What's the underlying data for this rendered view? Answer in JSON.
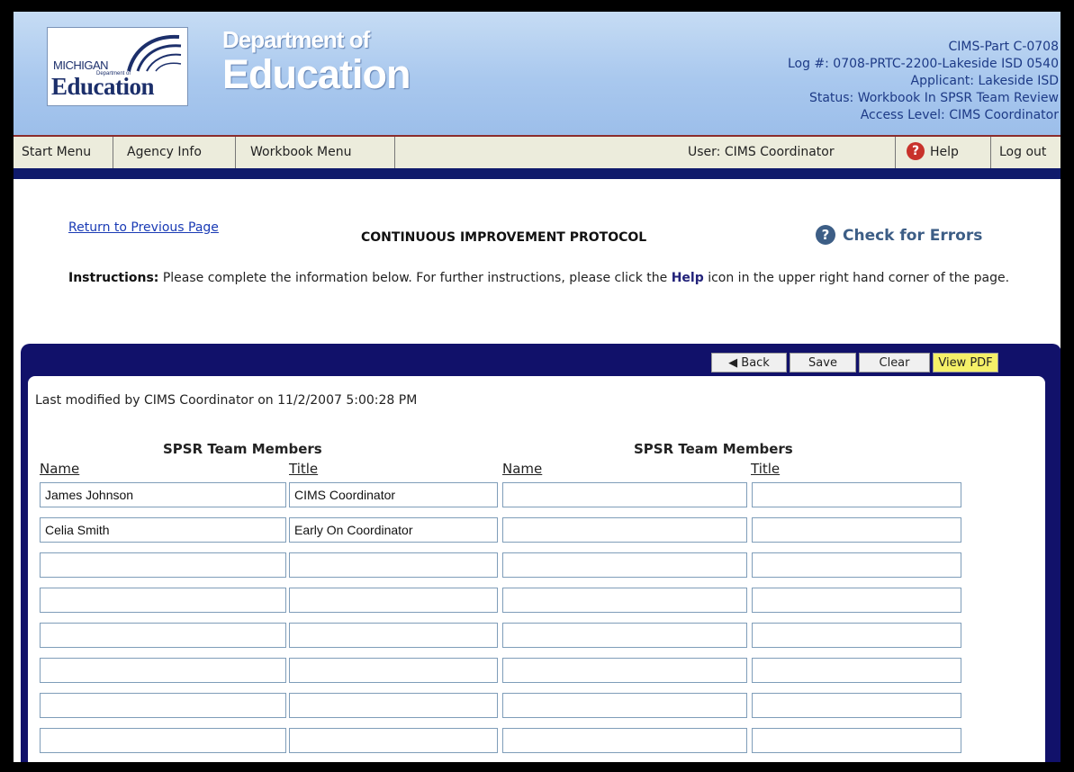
{
  "header": {
    "logo": {
      "michigan": "MICHIGAN",
      "dept_of": "Department of",
      "education": "Education"
    },
    "dept_line1": "Department of",
    "dept_line2": "Education",
    "info": [
      "CIMS-Part C-0708",
      "Log #: 0708-PRTC-2200-Lakeside ISD 0540",
      "Applicant: Lakeside ISD",
      "Status: Workbook In SPSR Team Review",
      "Access Level: CIMS Coordinator"
    ]
  },
  "nav": {
    "start_menu": "Start Menu",
    "agency_info": "Agency Info",
    "workbook_menu": "Workbook Menu",
    "user": "User: CIMS Coordinator",
    "help": "Help",
    "logout": "Log out"
  },
  "content": {
    "return_link": "Return to Previous Page",
    "title": "CONTINUOUS IMPROVEMENT PROTOCOL",
    "check_errors": "Check for Errors",
    "instructions_label": "Instructions:",
    "instructions_pre": "Please complete the information below.  For further instructions, please click the",
    "instructions_help": "Help",
    "instructions_post": "icon in the upper right hand corner of the page."
  },
  "toolbar": {
    "back": "◀ Back",
    "save": "Save",
    "clear": "Clear",
    "view_pdf": "View PDF"
  },
  "modified": "Last modified by CIMS Coordinator on 11/2/2007 5:00:28 PM",
  "team": {
    "section_left": "SPSR Team Members",
    "section_right": "SPSR Team Members",
    "name_header": "Name",
    "title_header": "Title",
    "rows": [
      {
        "name": "James Johnson",
        "title": "CIMS Coordinator",
        "name2": "",
        "title2": ""
      },
      {
        "name": "Celia Smith",
        "title": "Early On Coordinator",
        "name2": "",
        "title2": ""
      },
      {
        "name": "",
        "title": "",
        "name2": "",
        "title2": ""
      },
      {
        "name": "",
        "title": "",
        "name2": "",
        "title2": ""
      },
      {
        "name": "",
        "title": "",
        "name2": "",
        "title2": ""
      },
      {
        "name": "",
        "title": "",
        "name2": "",
        "title2": ""
      },
      {
        "name": "",
        "title": "",
        "name2": "",
        "title2": ""
      },
      {
        "name": "",
        "title": "",
        "name2": "",
        "title2": ""
      }
    ]
  },
  "colors": {
    "header_blue": "#a9c8ee",
    "nav_dark": "#0f1a6b",
    "panel_navy": "#11116a",
    "pdf_yellow": "#f5f068",
    "help_red": "#c8322b"
  }
}
